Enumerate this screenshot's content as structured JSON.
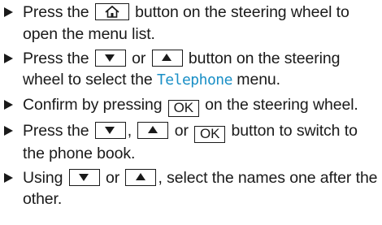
{
  "steps": [
    {
      "t1": "Press the ",
      "key1_icon": "home-icon",
      "t2": " button on the steering wheel to open the menu list."
    },
    {
      "t1": "Press the ",
      "key1_icon": "arrow-down-icon",
      "t2": " or ",
      "key2_icon": "arrow-up-icon",
      "t3": " button on the steering wheel to select the ",
      "highlight": "Telephone",
      "t4": " menu."
    },
    {
      "t1": "Confirm by pressing ",
      "key_ok": "OK",
      "t2": " on the steering wheel."
    },
    {
      "t1": "Press the ",
      "key1_icon": "arrow-down-icon",
      "t2": ", ",
      "key2_icon": "arrow-up-icon",
      "t3": " or ",
      "key_ok": "OK",
      "t4": " button to switch to the phone book."
    },
    {
      "t1": "Using ",
      "key1_icon": "arrow-down-icon",
      "t2": " or ",
      "key2_icon": "arrow-up-icon",
      "t3": ", select the names one after the other."
    }
  ],
  "colors": {
    "text": "#1a1a1a",
    "display_text": "#1a8fc6"
  }
}
